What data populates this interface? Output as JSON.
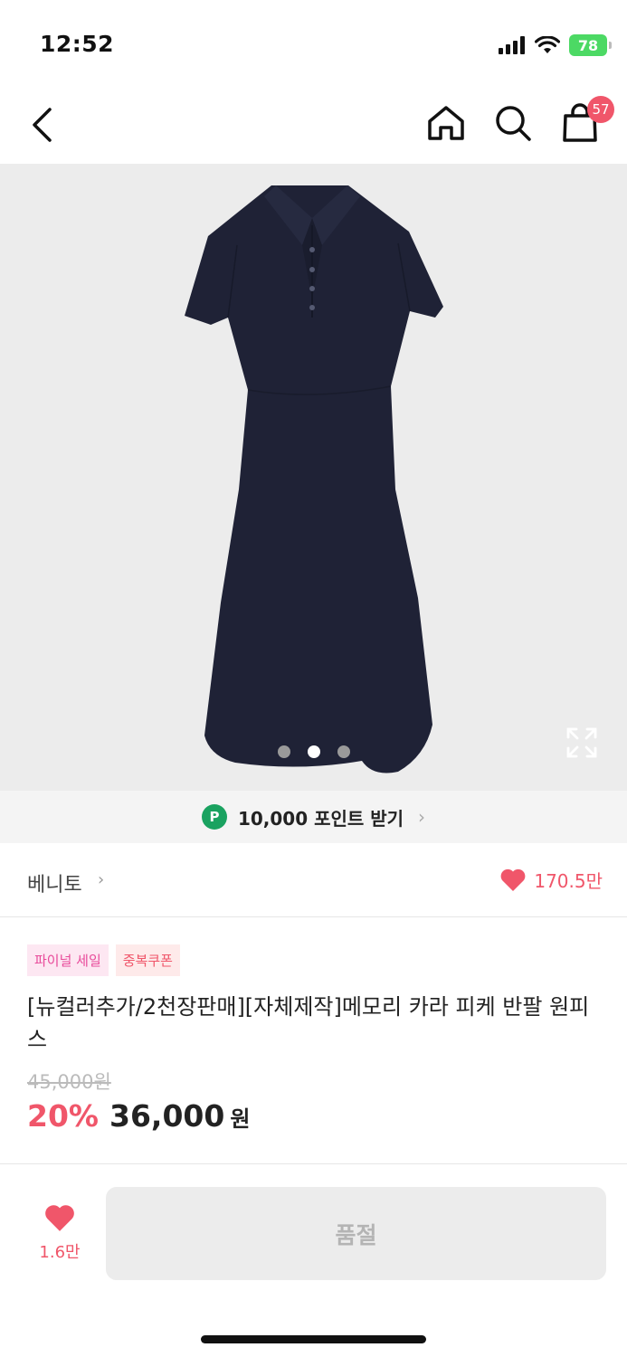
{
  "status_bar": {
    "time": "12:52",
    "battery": "78",
    "icons": [
      "signal-icon",
      "wifi-icon",
      "battery-icon"
    ]
  },
  "nav": {
    "back_icon": "chevron-left-icon",
    "home_icon": "home-icon",
    "search_icon": "search-icon",
    "cart_icon": "shopping-bag-icon",
    "cart_count": "57"
  },
  "gallery": {
    "image": "navy polo collar short-sleeve dress",
    "slide_count": 3,
    "active_index": 1,
    "expand_icon": "expand-icon"
  },
  "points": {
    "badge": "P",
    "text": "10,000 포인트 받기",
    "chevron": "›"
  },
  "brand": {
    "name": "베니토",
    "chevron": "›",
    "likes": "170.5만"
  },
  "product": {
    "tags": [
      "파이널 세일",
      "중복쿠폰"
    ],
    "title": "[뉴컬러추가/2천장판매][자체제작]메모리 카라 피케 반팔 원피스",
    "original_price": "45,000원",
    "discount": "20%",
    "price": "36,000",
    "currency": "원"
  },
  "bottom_bar": {
    "wish_count": "1.6만",
    "buy_button": "품절"
  },
  "colors": {
    "accent": "#f0566a",
    "points_green": "#1aa260",
    "dress_navy": "#1f2236"
  }
}
